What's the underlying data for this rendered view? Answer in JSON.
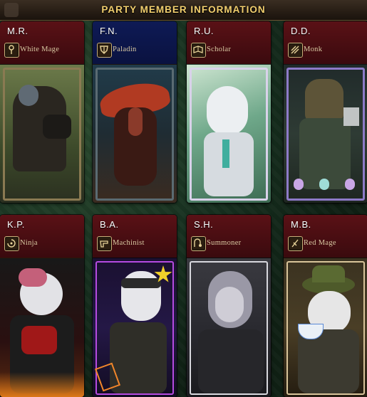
{
  "header": {
    "title": "PARTY MEMBER INFORMATION"
  },
  "members": [
    {
      "name": "M.R.",
      "job": "White Mage",
      "job_icon": "white-mage-icon"
    },
    {
      "name": "F.N.",
      "job": "Paladin",
      "job_icon": "paladin-icon"
    },
    {
      "name": "R.U.",
      "job": "Scholar",
      "job_icon": "scholar-icon"
    },
    {
      "name": "D.D.",
      "job": "Monk",
      "job_icon": "monk-icon"
    },
    {
      "name": "K.P.",
      "job": "Ninja",
      "job_icon": "ninja-icon"
    },
    {
      "name": "B.A.",
      "job": "Machinist",
      "job_icon": "machinist-icon"
    },
    {
      "name": "S.H.",
      "job": "Summoner",
      "job_icon": "summoner-icon"
    },
    {
      "name": "M.B.",
      "job": "Red Mage",
      "job_icon": "red-mage-icon"
    }
  ],
  "colors": {
    "title": "#f2cf6e",
    "card_red": "#5a1116",
    "card_blue": "#0e1a55"
  }
}
